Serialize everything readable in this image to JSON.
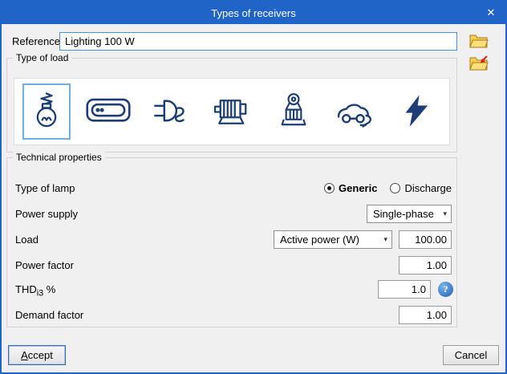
{
  "window": {
    "title": "Types of receivers"
  },
  "glyphs": {
    "close": "✕",
    "chevron": "▾",
    "help": "?"
  },
  "reference": {
    "label": "Reference",
    "value": "Lighting 100 W"
  },
  "side_buttons": [
    {
      "icon": "folder-open"
    },
    {
      "icon": "folder-export-red-arrow"
    }
  ],
  "type_of_load": {
    "title": "Type of load",
    "items": [
      {
        "icon": "incandescent-lamp",
        "selected": true
      },
      {
        "icon": "fluorescent-luminaire",
        "selected": false
      },
      {
        "icon": "plug",
        "selected": false
      },
      {
        "icon": "motor",
        "selected": false
      },
      {
        "icon": "hoist-machine",
        "selected": false
      },
      {
        "icon": "electric-vehicle",
        "selected": false
      },
      {
        "icon": "lightning-bolt",
        "selected": false
      }
    ]
  },
  "technical": {
    "title": "Technical properties",
    "type_of_lamp": {
      "label": "Type of lamp",
      "options": [
        {
          "label": "Generic",
          "selected": true
        },
        {
          "label": "Discharge",
          "selected": false
        }
      ]
    },
    "power_supply": {
      "label": "Power supply",
      "value": "Single-phase"
    },
    "load": {
      "label": "Load",
      "mode": "Active power (W)",
      "value": "100.00"
    },
    "power_factor": {
      "label": "Power factor",
      "value": "1.00"
    },
    "thd": {
      "label_prefix": "THD",
      "label_sub": "i3",
      "label_suffix": " %",
      "value": "1.0"
    },
    "demand_factor": {
      "label": "Demand factor",
      "value": "1.00"
    }
  },
  "footer": {
    "accept_initial": "A",
    "accept_rest": "ccept",
    "cancel": "Cancel"
  }
}
